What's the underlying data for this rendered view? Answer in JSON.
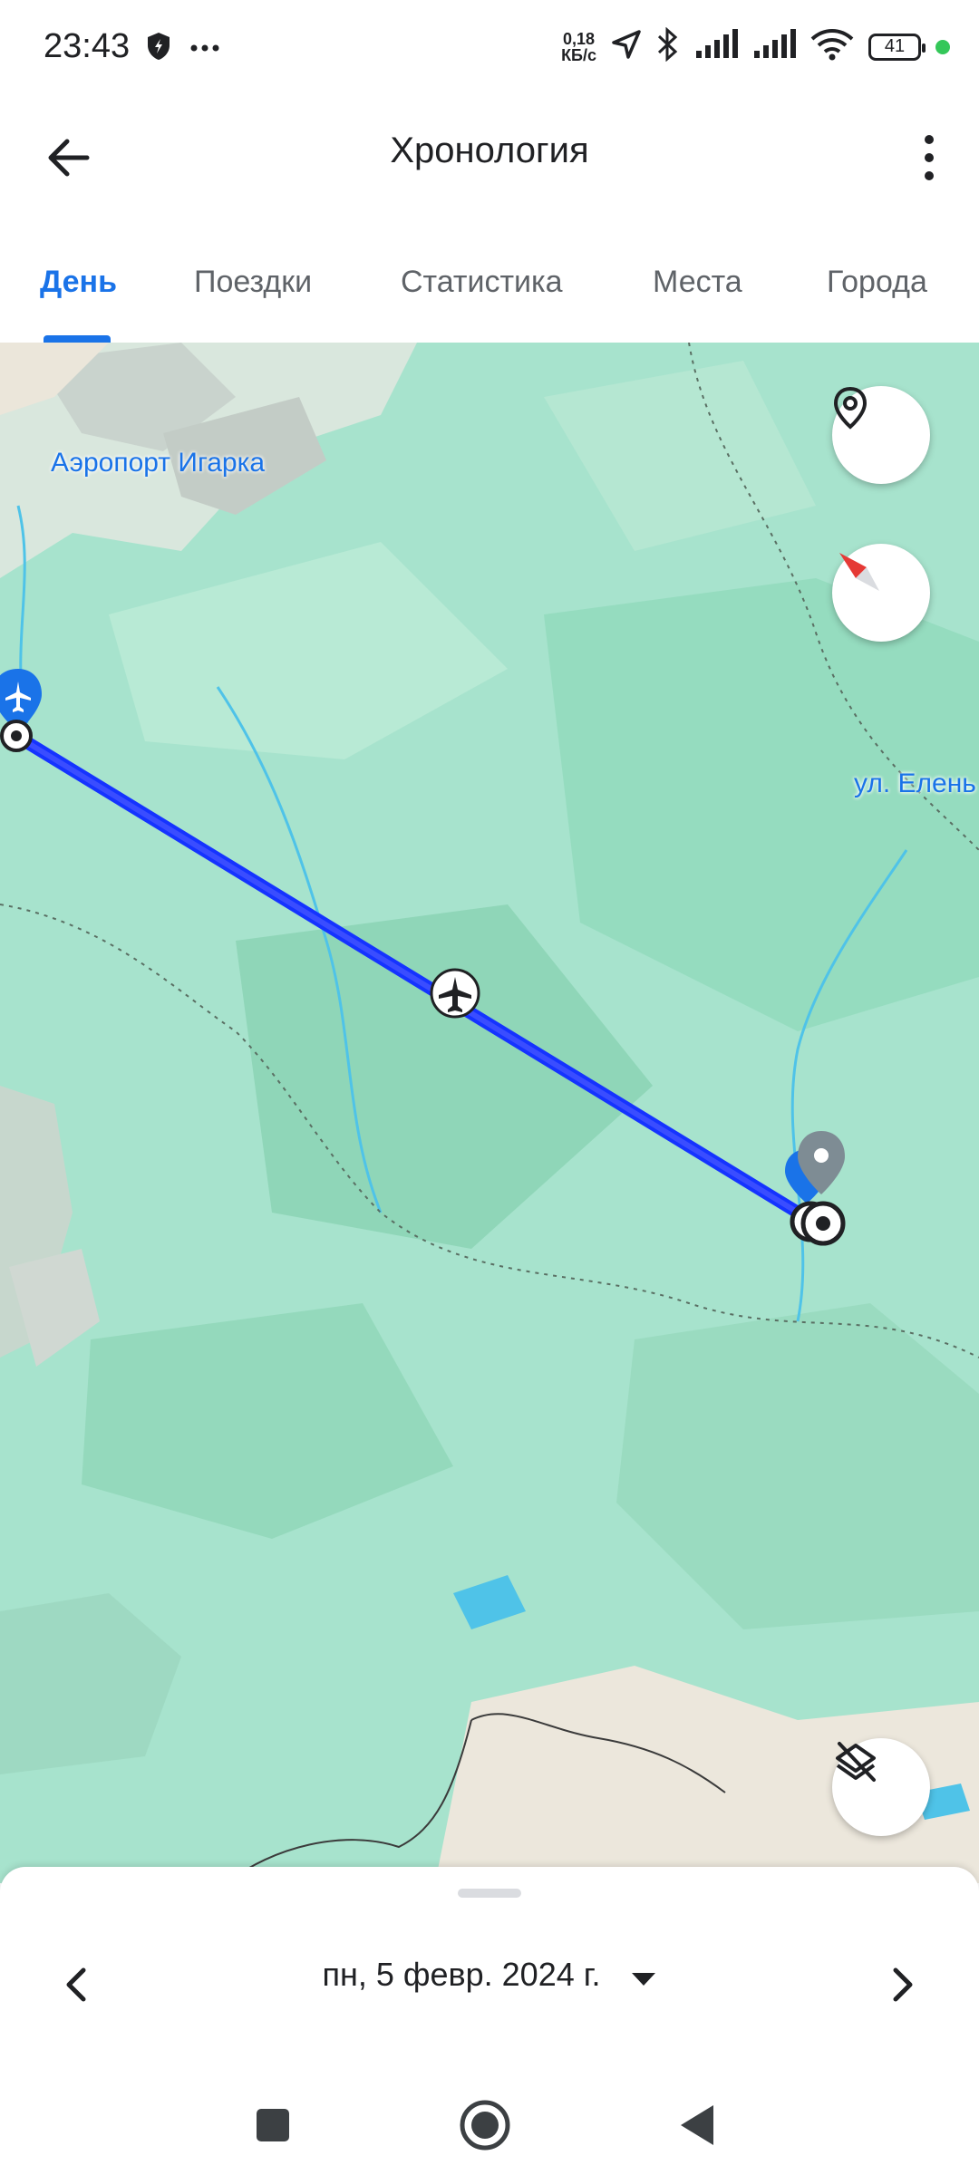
{
  "status_bar": {
    "time": "23:43",
    "speed_value": "0,18",
    "speed_unit": "КБ/с",
    "battery": "41",
    "icons": [
      "shield-icon",
      "more-dots-icon",
      "location-arrow-icon",
      "bluetooth-icon",
      "signal-icon",
      "signal-icon",
      "wifi-icon",
      "battery-icon"
    ]
  },
  "app_bar": {
    "title": "Хронология",
    "back_icon": "arrow-back-icon",
    "menu_icon": "more-vert-icon"
  },
  "tabs": [
    {
      "label": "День",
      "active": true
    },
    {
      "label": "Поездки",
      "active": false
    },
    {
      "label": "Статистика",
      "active": false
    },
    {
      "label": "Места",
      "active": false
    },
    {
      "label": "Города",
      "active": false
    }
  ],
  "map": {
    "start_label": "Аэропорт Игарка",
    "end_label": "ул. Елень",
    "route_color": "#1a3cff",
    "buttons": [
      "place-pin-icon",
      "compass-icon",
      "layers-off-icon"
    ]
  },
  "bottom_sheet": {
    "date": "пн, 5 февр. 2024 г."
  },
  "colors": {
    "accent": "#1a73e8",
    "map_green": "#a7e3cd"
  }
}
